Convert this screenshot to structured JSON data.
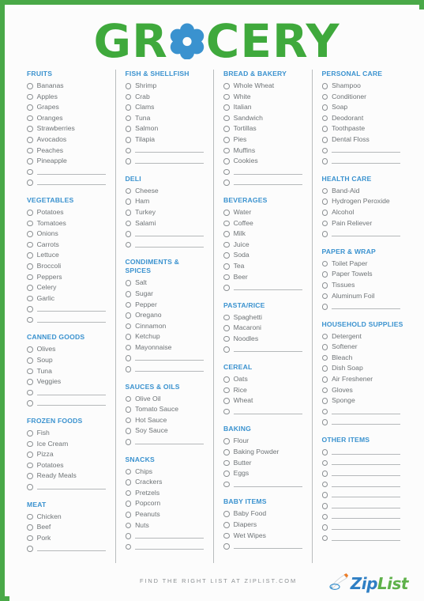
{
  "header": {
    "title": "GROCERY",
    "word_before": "GR",
    "word_after": "CERY",
    "flower_icon": "flower-icon",
    "green": "#3fa93c",
    "blue": "#3a92cf"
  },
  "colors": {
    "border_green": "#4aa948",
    "heading_blue": "#3a92cf",
    "item_gray": "#6e7376",
    "divider_gray": "#b9bcbe",
    "logo_blue": "#2f7fc4",
    "logo_green": "#5fb14a"
  },
  "columns": [
    {
      "sections": [
        {
          "title": "FRUITS",
          "items": [
            "Bananas",
            "Apples",
            "Grapes",
            "Oranges",
            "Strawberries",
            "Avocados",
            "Peaches",
            "Pineapple"
          ],
          "blanks": 2
        },
        {
          "title": "VEGETABLES",
          "items": [
            "Potatoes",
            "Tomatoes",
            "Onions",
            "Carrots",
            "Lettuce",
            "Broccoli",
            "Peppers",
            "Celery",
            "Garlic"
          ],
          "blanks": 2
        },
        {
          "title": "CANNED GOODS",
          "items": [
            "Olives",
            "Soup",
            "Tuna",
            "Veggies"
          ],
          "blanks": 2
        },
        {
          "title": "FROZEN FOODS",
          "items": [
            "Fish",
            "Ice Cream",
            "Pizza",
            "Potatoes",
            "Ready Meals"
          ],
          "blanks": 1
        },
        {
          "title": "MEAT",
          "items": [
            "Chicken",
            "Beef",
            "Pork"
          ],
          "blanks": 1
        }
      ]
    },
    {
      "sections": [
        {
          "title": "FISH & SHELLFISH",
          "items": [
            "Shrimp",
            "Crab",
            "Clams",
            "Tuna",
            "Salmon",
            "Tilapia"
          ],
          "blanks": 2
        },
        {
          "title": "DELI",
          "items": [
            "Cheese",
            "Ham",
            "Turkey",
            "Salami"
          ],
          "blanks": 2
        },
        {
          "title": "CONDIMENTS & SPICES",
          "items": [
            "Salt",
            "Sugar",
            "Pepper",
            "Oregano",
            "Cinnamon",
            "Ketchup",
            "Mayonnaise"
          ],
          "blanks": 2
        },
        {
          "title": "SAUCES & OILS",
          "items": [
            "Olive Oil",
            "Tomato Sauce",
            "Hot Sauce",
            "Soy Sauce"
          ],
          "blanks": 1
        },
        {
          "title": "SNACKS",
          "items": [
            "Chips",
            "Crackers",
            "Pretzels",
            "Popcorn",
            "Peanuts",
            "Nuts"
          ],
          "blanks": 2
        }
      ]
    },
    {
      "sections": [
        {
          "title": "BREAD & BAKERY",
          "items": [
            "Whole Wheat",
            "White",
            "Italian",
            "Sandwich",
            "Tortillas",
            "Pies",
            "Muffins",
            "Cookies"
          ],
          "blanks": 2
        },
        {
          "title": "BEVERAGES",
          "items": [
            "Water",
            "Coffee",
            "Milk",
            "Juice",
            "Soda",
            "Tea",
            "Beer"
          ],
          "blanks": 1
        },
        {
          "title": "PASTA/RICE",
          "items": [
            "Spaghetti",
            "Macaroni",
            "Noodles"
          ],
          "blanks": 1
        },
        {
          "title": "CEREAL",
          "items": [
            "Oats",
            "Rice",
            "Wheat"
          ],
          "blanks": 1
        },
        {
          "title": "BAKING",
          "items": [
            "Flour",
            "Baking Powder",
            "Butter",
            "Eggs"
          ],
          "blanks": 1
        },
        {
          "title": "BABY ITEMS",
          "items": [
            "Baby Food",
            "Diapers",
            "Wet Wipes"
          ],
          "blanks": 1
        }
      ]
    },
    {
      "sections": [
        {
          "title": "PERSONAL CARE",
          "items": [
            "Shampoo",
            "Conditioner",
            "Soap",
            "Deodorant",
            "Toothpaste",
            "Dental Floss"
          ],
          "blanks": 2
        },
        {
          "title": "HEALTH CARE",
          "items": [
            "Band-Aid",
            "Hydrogen Peroxide",
            "Alcohol",
            "Pain Reliever"
          ],
          "blanks": 1
        },
        {
          "title": "PAPER & WRAP",
          "items": [
            "Toilet Paper",
            "Paper Towels",
            "Tissues",
            "Aluminum Foil"
          ],
          "blanks": 1
        },
        {
          "title": "HOUSEHOLD SUPPLIES",
          "items": [
            "Detergent",
            "Softener",
            "Bleach",
            "Dish Soap",
            "Air Freshener",
            "Gloves",
            "Sponge"
          ],
          "blanks": 2
        },
        {
          "title": "OTHER ITEMS",
          "items": [],
          "blanks": 9
        }
      ]
    }
  ],
  "footer": {
    "tagline": "FIND THE RIGHT LIST AT ZIPLIST.COM",
    "logo_zip": "Zip",
    "logo_list": "List",
    "logo_icon": "pencil-icon"
  }
}
